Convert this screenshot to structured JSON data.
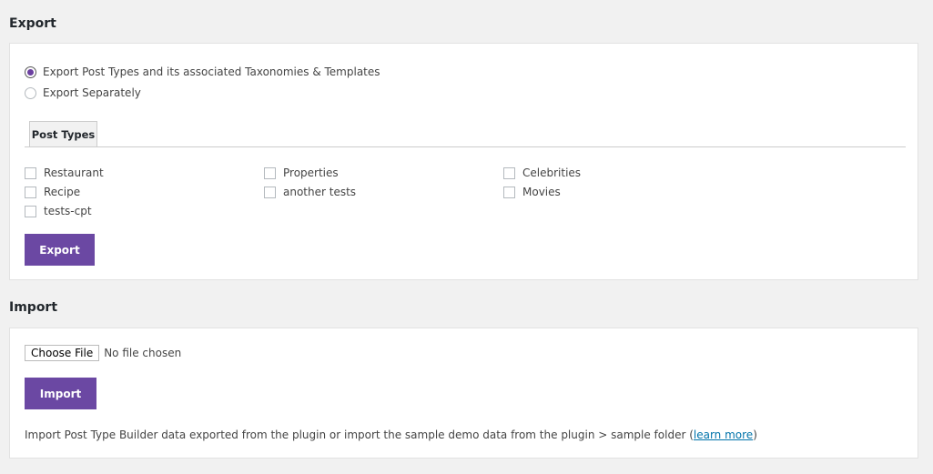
{
  "export": {
    "title": "Export",
    "radios": [
      {
        "label": "Export Post Types and its associated Taxonomies & Templates",
        "checked": true
      },
      {
        "label": "Export Separately",
        "checked": false
      }
    ],
    "tab": "Post Types",
    "checkboxes": [
      "Restaurant",
      "Recipe",
      "tests-cpt",
      "Properties",
      "another tests",
      "Celebrities",
      "Movies"
    ],
    "button": "Export"
  },
  "import": {
    "title": "Import",
    "choose_file": "Choose File",
    "file_status": "No file chosen",
    "button": "Import",
    "note": "Import Post Type Builder data exported from the plugin or import the sample demo data from the plugin > sample folder (",
    "link": "learn more",
    "note_end": ")"
  },
  "colors": {
    "accent": "#6b48a3",
    "link": "#0073aa"
  }
}
